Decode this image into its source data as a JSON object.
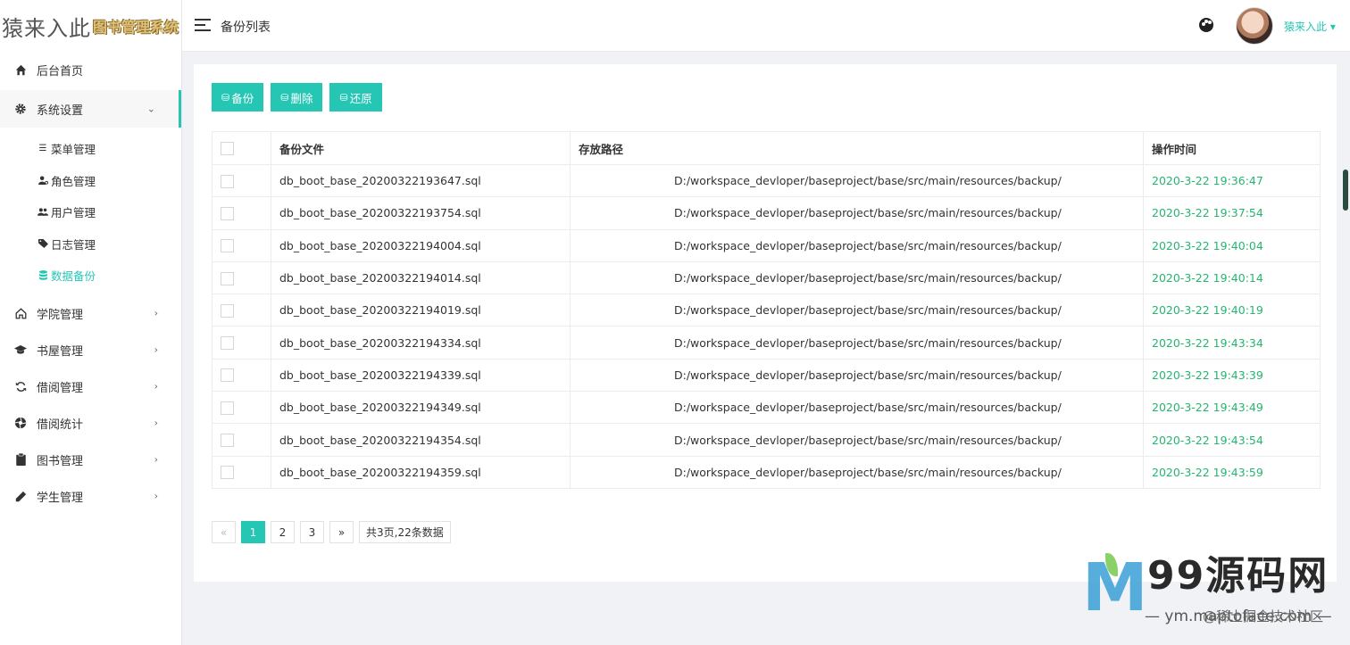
{
  "logo": {
    "main": "猿来入此",
    "sub": "图书管理系统"
  },
  "sidebar": {
    "items": [
      {
        "label": "后台首页",
        "icon": "home-icon"
      },
      {
        "label": "系统设置",
        "icon": "gear-icon",
        "expanded": true
      },
      {
        "label": "学院管理",
        "icon": "home-outline-icon"
      },
      {
        "label": "书屋管理",
        "icon": "graduation-cap-icon"
      },
      {
        "label": "借阅管理",
        "icon": "refresh-icon"
      },
      {
        "label": "借阅统计",
        "icon": "aperture-icon"
      },
      {
        "label": "图书管理",
        "icon": "clipboard-icon"
      },
      {
        "label": "学生管理",
        "icon": "pencil-icon"
      }
    ],
    "submenu": [
      {
        "label": "菜单管理",
        "icon": "list-icon"
      },
      {
        "label": "角色管理",
        "icon": "user-cog-icon"
      },
      {
        "label": "用户管理",
        "icon": "users-icon"
      },
      {
        "label": "日志管理",
        "icon": "tag-icon"
      },
      {
        "label": "数据备份",
        "icon": "database-icon",
        "active": true
      }
    ]
  },
  "header": {
    "title": "备份列表",
    "user_name": "猿来入此 ▾"
  },
  "toolbar": {
    "backup_label": "备份",
    "delete_label": "删除",
    "restore_label": "还原"
  },
  "table": {
    "columns": [
      "备份文件",
      "存放路径",
      "操作时间"
    ],
    "rows": [
      {
        "file": "db_boot_base_20200322193647.sql",
        "path": "D:/workspace_devloper/baseproject/base/src/main/resources/backup/",
        "time": "2020-3-22 19:36:47"
      },
      {
        "file": "db_boot_base_20200322193754.sql",
        "path": "D:/workspace_devloper/baseproject/base/src/main/resources/backup/",
        "time": "2020-3-22 19:37:54"
      },
      {
        "file": "db_boot_base_20200322194004.sql",
        "path": "D:/workspace_devloper/baseproject/base/src/main/resources/backup/",
        "time": "2020-3-22 19:40:04"
      },
      {
        "file": "db_boot_base_20200322194014.sql",
        "path": "D:/workspace_devloper/baseproject/base/src/main/resources/backup/",
        "time": "2020-3-22 19:40:14"
      },
      {
        "file": "db_boot_base_20200322194019.sql",
        "path": "D:/workspace_devloper/baseproject/base/src/main/resources/backup/",
        "time": "2020-3-22 19:40:19"
      },
      {
        "file": "db_boot_base_20200322194334.sql",
        "path": "D:/workspace_devloper/baseproject/base/src/main/resources/backup/",
        "time": "2020-3-22 19:43:34"
      },
      {
        "file": "db_boot_base_20200322194339.sql",
        "path": "D:/workspace_devloper/baseproject/base/src/main/resources/backup/",
        "time": "2020-3-22 19:43:39"
      },
      {
        "file": "db_boot_base_20200322194349.sql",
        "path": "D:/workspace_devloper/baseproject/base/src/main/resources/backup/",
        "time": "2020-3-22 19:43:49"
      },
      {
        "file": "db_boot_base_20200322194354.sql",
        "path": "D:/workspace_devloper/baseproject/base/src/main/resources/backup/",
        "time": "2020-3-22 19:43:54"
      },
      {
        "file": "db_boot_base_20200322194359.sql",
        "path": "D:/workspace_devloper/baseproject/base/src/main/resources/backup/",
        "time": "2020-3-22 19:43:59"
      }
    ]
  },
  "pagination": {
    "prev": "«",
    "pages": [
      "1",
      "2",
      "3"
    ],
    "current": "1",
    "next": "»",
    "summary": "共3页,22条数据"
  },
  "watermark": {
    "text": "99源码网",
    "url": "— ym.maptoface.com —",
    "community": "@稀土掘金技术社区"
  },
  "colors": {
    "accent": "#26c6b5",
    "time_text": "#26b56f"
  }
}
